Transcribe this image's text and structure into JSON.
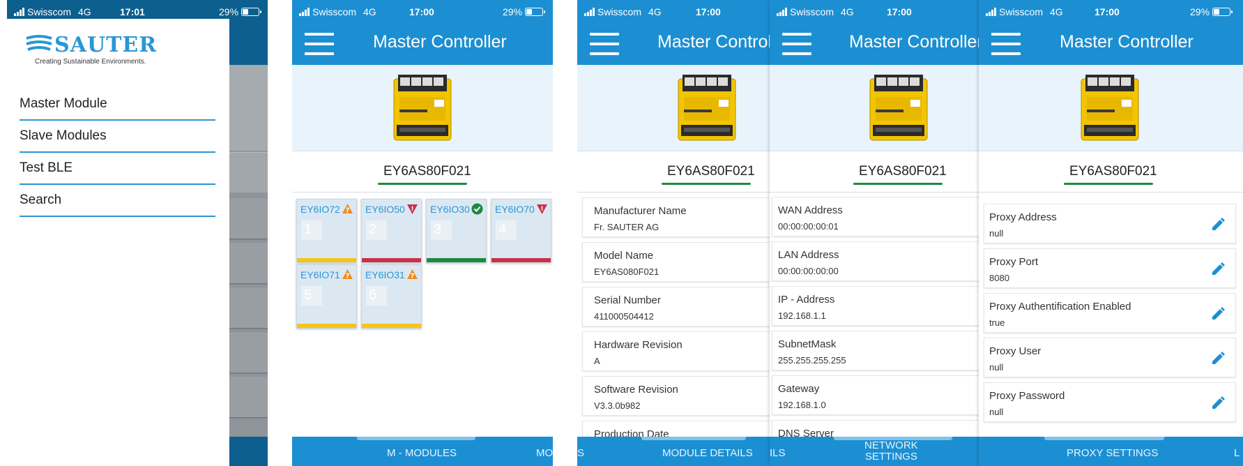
{
  "status": {
    "carrier": "Swisscom",
    "network": "4G",
    "battery": "29%"
  },
  "colors": {
    "primary": "#1c8fd3",
    "accent_line": "#1d8a3d",
    "status_warning": "#f5c518",
    "status_error": "#c9314a",
    "status_ok": "#1d8a3d"
  },
  "screen1": {
    "time": "17:01",
    "logo": {
      "brand": "SAUTER",
      "tagline": "Creating Sustainable Environments."
    },
    "menu": [
      "Master Module",
      "Slave Modules",
      "Test BLE",
      "Search"
    ]
  },
  "screen2": {
    "time": "17:00",
    "title": "Master Controller",
    "device_id": "EY6AS80F021",
    "modules": [
      {
        "name": "EY6IO72",
        "number": "1",
        "status": "warning",
        "badge": "warning-icon"
      },
      {
        "name": "EY6IO50",
        "number": "2",
        "status": "error",
        "badge": "error-icon"
      },
      {
        "name": "EY6IO30",
        "number": "3",
        "status": "ok",
        "badge": "check-icon"
      },
      {
        "name": "EY6IO70",
        "number": "4",
        "status": "error",
        "badge": "error-icon"
      },
      {
        "name": "EY6IO71",
        "number": "5",
        "status": "warning",
        "badge": "warning-icon"
      },
      {
        "name": "EY6IO31",
        "number": "6",
        "status": "warning",
        "badge": "warning-icon"
      }
    ],
    "footer": {
      "active": "M - MODULES",
      "next": "MO"
    }
  },
  "screen3": {
    "time": "17:00",
    "title": "Master Controll",
    "device_id": "EY6AS80F021",
    "details": [
      {
        "label": "Manufacturer Name",
        "value": "Fr. SAUTER AG"
      },
      {
        "label": "Model Name",
        "value": "EY6AS080F021"
      },
      {
        "label": "Serial Number",
        "value": "411000504412"
      },
      {
        "label": "Hardware Revision",
        "value": "A"
      },
      {
        "label": "Software Revision",
        "value": "V3.3.0b982"
      },
      {
        "label": "Production Date",
        "value": ""
      }
    ],
    "footer": {
      "prev": "S",
      "active": "MODULE DETAILS"
    }
  },
  "screen4": {
    "time": "17:00",
    "title": "Master Controller",
    "device_id": "EY6AS80F021",
    "network": [
      {
        "label": "WAN Address",
        "value": "00:00:00:00:01"
      },
      {
        "label": "LAN Address",
        "value": "00:00:00:00:00"
      },
      {
        "label": "IP - Address",
        "value": "192.168.1.1"
      },
      {
        "label": "SubnetMask",
        "value": "255.255.255.255"
      },
      {
        "label": "Gateway",
        "value": "192.168.1.0"
      },
      {
        "label": "DNS Server",
        "value": ""
      }
    ],
    "footer": {
      "prev": "ILS",
      "active_line1": "NETWORK",
      "active_line2": "SETTINGS"
    }
  },
  "screen5": {
    "time": "17:00",
    "battery": "29%",
    "title": "Master Controller",
    "device_id": "EY6AS80F021",
    "proxy": [
      {
        "label": "Proxy Address",
        "value": "null"
      },
      {
        "label": "Proxy Port",
        "value": "8080"
      },
      {
        "label": "Proxy Authentification Enabled",
        "value": "true"
      },
      {
        "label": "Proxy User",
        "value": "null"
      },
      {
        "label": "Proxy Password",
        "value": "null"
      }
    ],
    "footer": {
      "active": "PROXY SETTINGS",
      "next": "L"
    }
  }
}
